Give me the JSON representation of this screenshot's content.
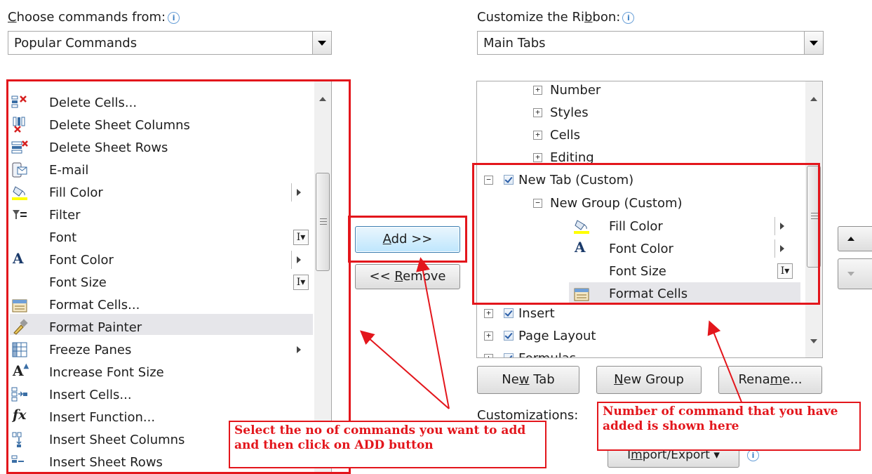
{
  "left_panel": {
    "label_pre": "",
    "label_ul": "C",
    "label_post": "hoose commands from:",
    "combo_value": "Popular Commands",
    "items": [
      {
        "label": "Delete Cells...",
        "icon": "delete-cells-icon"
      },
      {
        "label": "Delete Sheet Columns",
        "icon": "delete-columns-icon"
      },
      {
        "label": "Delete Sheet Rows",
        "icon": "delete-rows-icon"
      },
      {
        "label": "E-mail",
        "icon": "email-icon"
      },
      {
        "label": "Fill Color",
        "icon": "fill-color-icon"
      },
      {
        "label": "Filter",
        "icon": "filter-icon"
      },
      {
        "label": "Font",
        "icon": ""
      },
      {
        "label": "Font Color",
        "icon": "font-color-icon"
      },
      {
        "label": "Font Size",
        "icon": ""
      },
      {
        "label": "Format Cells...",
        "icon": "format-cells-icon"
      },
      {
        "label": "Format Painter",
        "icon": "format-painter-icon"
      },
      {
        "label": "Freeze Panes",
        "icon": "freeze-panes-icon"
      },
      {
        "label": "Increase Font Size",
        "icon": "increase-font-size-icon"
      },
      {
        "label": "Insert Cells...",
        "icon": "insert-cells-icon"
      },
      {
        "label": "Insert Function...",
        "icon": "insert-function-icon"
      },
      {
        "label": "Insert Sheet Columns",
        "icon": "insert-columns-icon"
      },
      {
        "label": "Insert Sheet Rows",
        "icon": "insert-rows-icon"
      }
    ]
  },
  "middle": {
    "add_pre": "",
    "add_ul": "A",
    "add_post": "dd >>",
    "remove_pre": "<< ",
    "remove_ul": "R",
    "remove_post": "emove"
  },
  "right_panel": {
    "label_pre": "Customize the Ri",
    "label_ul": "b",
    "label_post": "bon:",
    "combo_value": "Main Tabs",
    "tree": {
      "number": "Number",
      "styles": "Styles",
      "cells": "Cells",
      "editing": "Editing",
      "new_tab": "New Tab (Custom)",
      "new_group": "New Group (Custom)",
      "fill_color": "Fill Color",
      "font_color": "Font Color",
      "font_size": "Font Size",
      "format_cells": "Format Cells",
      "insert": "Insert",
      "page_layout": "Page Layout",
      "formulas_partial": "Formulas"
    },
    "new_tab_pre": "Ne",
    "new_tab_ul": "w",
    "new_tab_post": " Tab",
    "new_group_pre": "",
    "new_group_ul": "N",
    "new_group_post": "ew Group",
    "rename_pre": "Rena",
    "rename_ul": "m",
    "rename_post": "e...",
    "customizations_label": "Customizations:",
    "import_export_pre": "I",
    "import_export_ul": "m",
    "import_export_post": "port/Export"
  },
  "notes": {
    "left": "Select the no of commands you want to add and then click on ADD button",
    "right": "Number of command that you have added is shown here"
  },
  "colors": {
    "annotation_red": "#e3161c",
    "fill_yellow": "#ffff00",
    "selection": "#e6e6ea"
  }
}
